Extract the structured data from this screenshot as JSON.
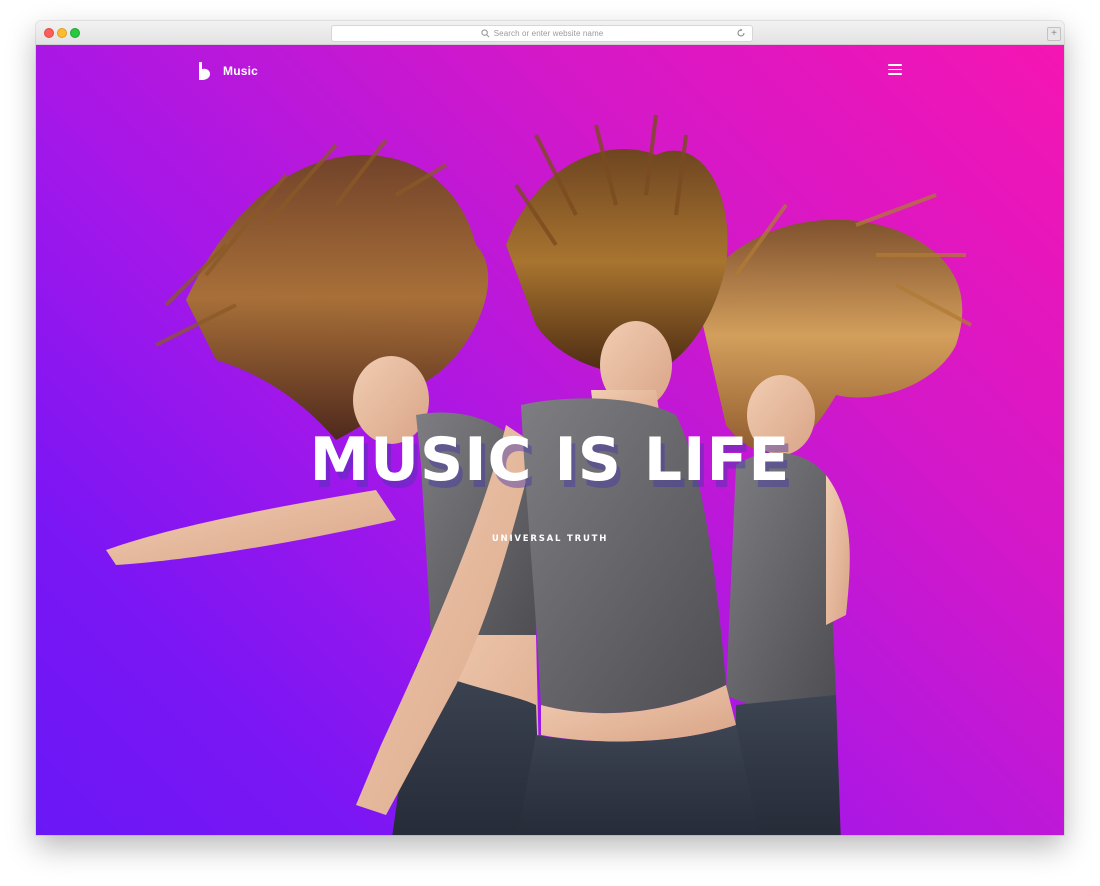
{
  "browser": {
    "address_placeholder": "Search or enter website name",
    "new_tab_label": "+"
  },
  "site": {
    "logo_text": "Music",
    "menu_icon": "hamburger-icon"
  },
  "hero": {
    "title": "MUSIC IS LIFE",
    "subtitle": "UNIVERSAL TRUTH",
    "image_description_icon": "dancing-women-photo"
  },
  "colors": {
    "gradient_start": "#f515b2",
    "gradient_end": "#6a17f6",
    "text": "#ffffff"
  }
}
